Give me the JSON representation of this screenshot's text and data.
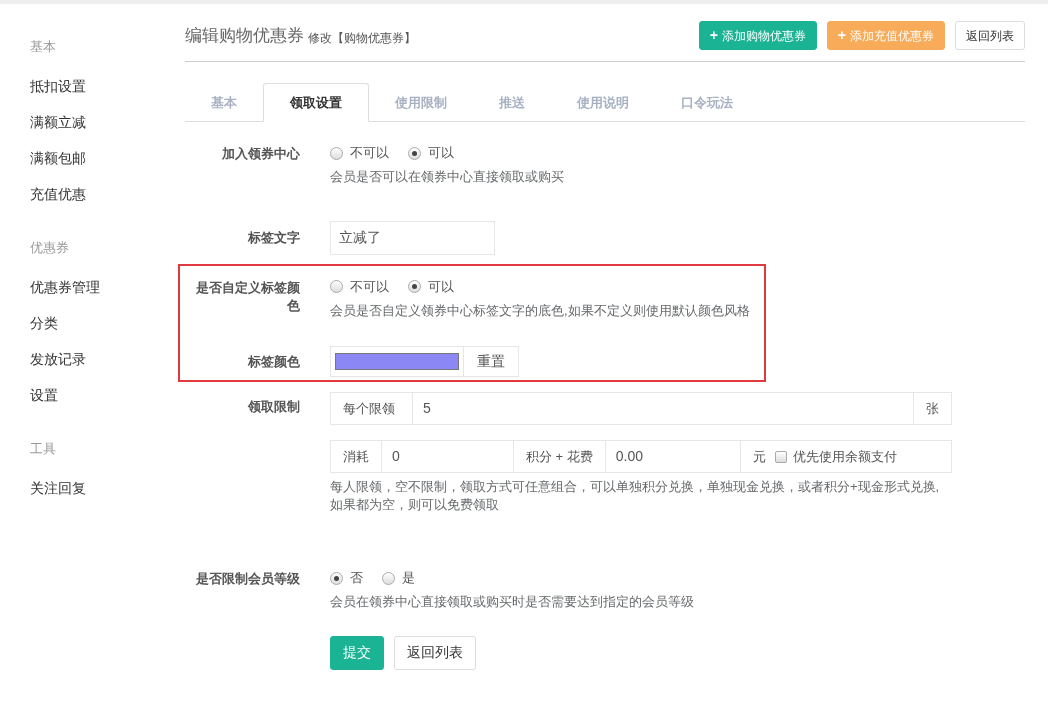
{
  "sidebar": {
    "groups": [
      {
        "title": "基本",
        "items": [
          {
            "label": "抵扣设置"
          },
          {
            "label": "满额立减"
          },
          {
            "label": "满额包邮"
          },
          {
            "label": "充值优惠"
          }
        ]
      },
      {
        "title": "优惠券",
        "items": [
          {
            "label": "优惠券管理"
          },
          {
            "label": "分类"
          },
          {
            "label": "发放记录"
          },
          {
            "label": "设置"
          }
        ]
      },
      {
        "title": "工具",
        "items": [
          {
            "label": "关注回复"
          }
        ]
      }
    ]
  },
  "header": {
    "title": "编辑购物优惠券",
    "subtitle": "修改【购物优惠券】",
    "buttons": [
      {
        "kind": "green",
        "icon": "+",
        "label": "添加购物优惠券"
      },
      {
        "kind": "orange",
        "icon": "+",
        "label": "添加充值优惠券"
      },
      {
        "kind": "plain",
        "label": "返回列表"
      }
    ]
  },
  "tabs": [
    {
      "label": "基本",
      "selected": false
    },
    {
      "label": "领取设置",
      "selected": true
    },
    {
      "label": "使用限制",
      "selected": false
    },
    {
      "label": "推送",
      "selected": false
    },
    {
      "label": "使用说明",
      "selected": false
    },
    {
      "label": "口令玩法",
      "selected": false
    }
  ],
  "form": {
    "rows": [
      {
        "kind": "radio",
        "label": "加入领券中心",
        "highlighted": false,
        "options": [
          {
            "label": "不可以",
            "selected": false
          },
          {
            "label": "可以",
            "selected": true
          }
        ],
        "help": "会员是否可以在领券中心直接领取或购买"
      },
      {
        "kind": "text",
        "label": "标签文字",
        "highlighted": false,
        "value": "立减了"
      },
      {
        "kind": "radio",
        "label": "是否自定义标签颜色",
        "highlighted": true,
        "options": [
          {
            "label": "不可以",
            "selected": false
          },
          {
            "label": "可以",
            "selected": true
          }
        ],
        "help": "会员是否自定义领券中心标签文字的底色,如果不定义则使用默认颜色风格"
      },
      {
        "kind": "color",
        "label": "标签颜色",
        "highlighted": true,
        "color": "#8b87f5",
        "button": "重置"
      },
      {
        "kind": "limit",
        "label": "领取限制",
        "highlighted": false,
        "line1": {
          "prefix": "每个限领",
          "value": "5",
          "suffix": "张"
        },
        "line2": {
          "prefix": "消耗",
          "value": "0",
          "middle": "积分 + 花费",
          "value2": "0.00",
          "suffix": "元",
          "checkbox": {
            "label": "优先使用余额支付",
            "checked": false
          }
        },
        "help": "每人限领，空不限制，领取方式可任意组合，可以单独积分兑换，单独现金兑换，或者积分+现金形式兑换,如果都为空，则可以免费领取"
      },
      {
        "kind": "radio",
        "label": "是否限制会员等级",
        "highlighted": false,
        "options": [
          {
            "label": "否",
            "selected": true
          },
          {
            "label": "是",
            "selected": false
          }
        ],
        "help": "会员在领券中心直接领取或购买时是否需要达到指定的会员等级"
      }
    ],
    "buttons": [
      {
        "kind": "primary",
        "label": "提交"
      },
      {
        "kind": "plain",
        "label": "返回列表"
      }
    ]
  }
}
